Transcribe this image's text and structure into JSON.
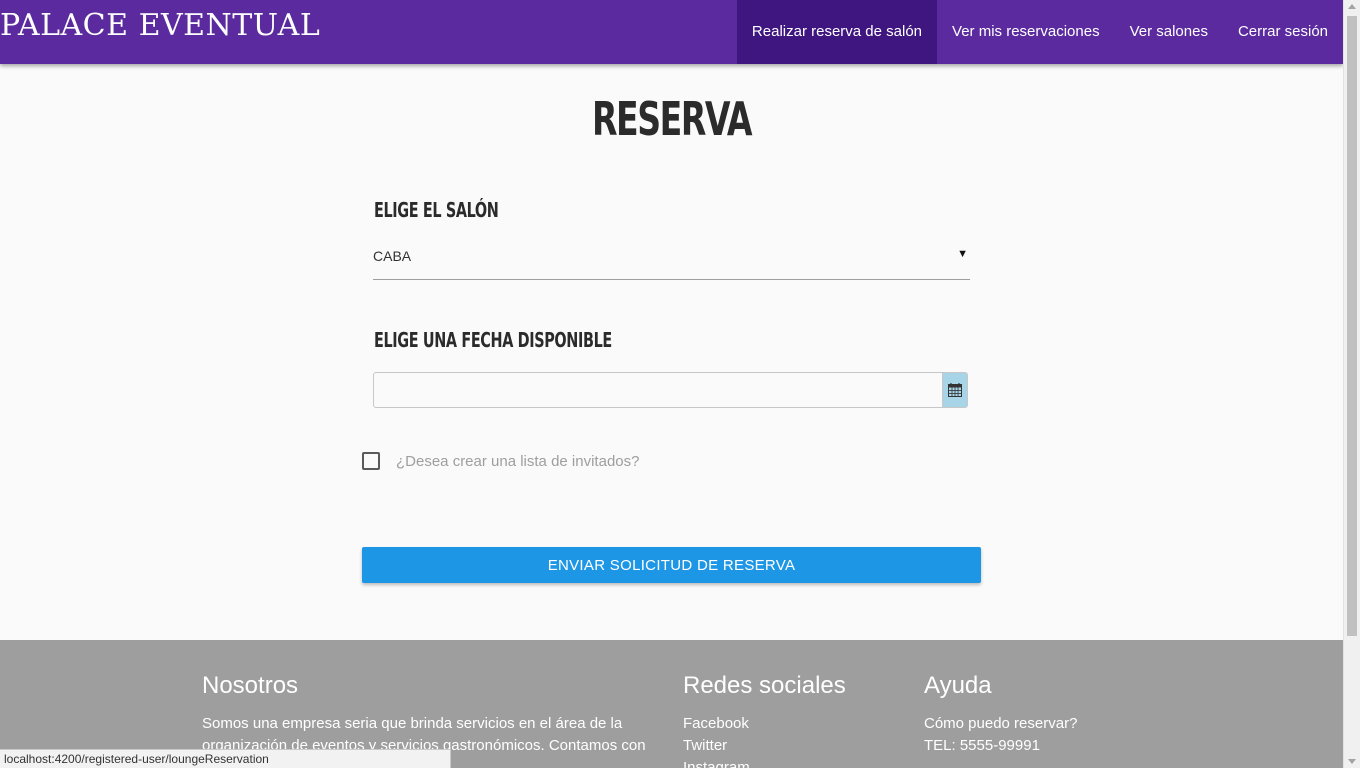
{
  "nav": {
    "brand": "PALACE EVENTUAL",
    "items": [
      {
        "label": "Realizar reserva de salón",
        "active": true
      },
      {
        "label": "Ver mis reservaciones",
        "active": false
      },
      {
        "label": "Ver salones",
        "active": false
      },
      {
        "label": "Cerrar sesión",
        "active": false
      }
    ]
  },
  "page": {
    "title": "RESERVA"
  },
  "form": {
    "salon_label": "ELIGE EL SALÓN",
    "salon_value": "CABA",
    "date_label": "ELIGE UNA FECHA DISPONIBLE",
    "date_value": "",
    "date_icon": "calendar-icon",
    "guests_checked": false,
    "guests_label": "¿Desea crear una lista de invitados?",
    "submit_label": "ENVIAR SOLICITUD DE RESERVA"
  },
  "footer": {
    "nosotros": {
      "title": "Nosotros",
      "text": "Somos una empresa seria que brinda servicios en el área de la organización de eventos y servicios gastronómicos. Contamos con"
    },
    "redes": {
      "title": "Redes sociales",
      "links": [
        "Facebook",
        "Twitter",
        "Instagram"
      ]
    },
    "ayuda": {
      "title": "Ayuda",
      "lines": [
        "Cómo puedo reservar?",
        "TEL: 5555-99991"
      ]
    }
  },
  "status_bar": {
    "url": "localhost:4200/registered-user/loungeReservation"
  },
  "colors": {
    "navbar": "#5a2a9e",
    "nav_active": "#3f1680",
    "button": "#1e96e6",
    "footer": "#9e9e9e"
  }
}
